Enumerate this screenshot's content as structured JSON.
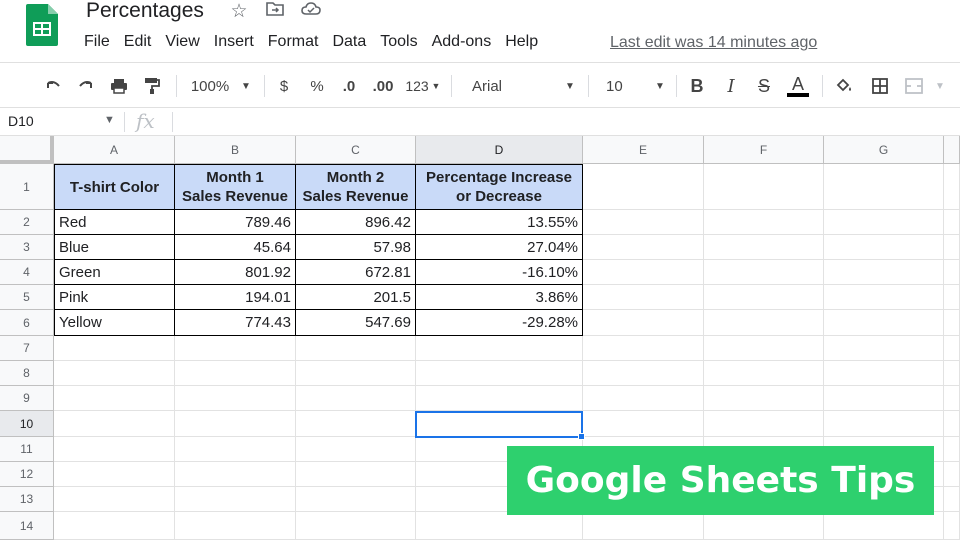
{
  "app": {
    "title": "Percentages",
    "last_edit": "Last edit was 14 minutes ago",
    "menu": [
      "File",
      "Edit",
      "View",
      "Insert",
      "Format",
      "Data",
      "Tools",
      "Add-ons",
      "Help"
    ]
  },
  "toolbar": {
    "zoom": "100%",
    "currency": "$",
    "percent": "%",
    "decrease_decimals": ".0",
    "increase_decimals": ".00",
    "more_formats": "123",
    "font": "Arial",
    "font_size": "10",
    "bold": "B",
    "italic": "I",
    "strikethrough": "S",
    "text_color": "A"
  },
  "formula_bar": {
    "name_box": "D10",
    "fx": "fx",
    "value": ""
  },
  "grid": {
    "columns": [
      "A",
      "B",
      "C",
      "D",
      "E",
      "F",
      "G"
    ],
    "rows": [
      "1",
      "2",
      "3",
      "4",
      "5",
      "6",
      "7",
      "8",
      "9",
      "10",
      "11",
      "12",
      "13",
      "14"
    ],
    "selected_cell": "D10",
    "header_fill": "#c9daf8",
    "headers": [
      "T-shirt Color",
      "Month 1\nSales Revenue",
      "Month 2\nSales Revenue",
      "Percentage Increase\nor Decrease"
    ],
    "data": [
      [
        "Red",
        "789.46",
        "896.42",
        "13.55%"
      ],
      [
        "Blue",
        "45.64",
        "57.98",
        "27.04%"
      ],
      [
        "Green",
        "801.92",
        "672.81",
        "-16.10%"
      ],
      [
        "Pink",
        "194.01",
        "201.5",
        "3.86%"
      ],
      [
        "Yellow",
        "774.43",
        "547.69",
        "-29.28%"
      ]
    ]
  },
  "banner": {
    "text": "Google Sheets Tips",
    "color": "#2ed06e"
  }
}
